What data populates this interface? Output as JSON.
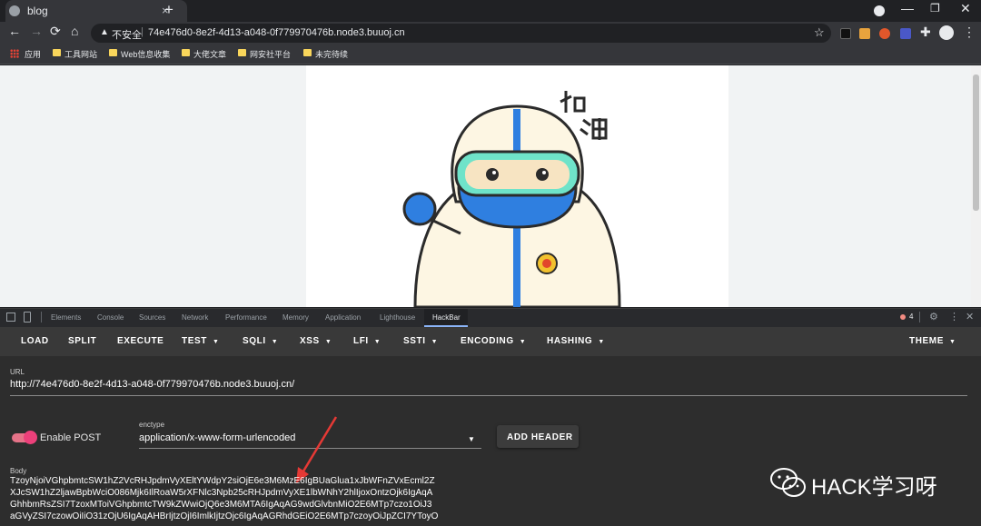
{
  "browser": {
    "tab_title": "blog",
    "new_tab": "+",
    "tab_close": "×",
    "window_controls": {
      "minimize": "—",
      "maximize": "❐",
      "close": "✕"
    },
    "nav": {
      "back": "←",
      "forward": "→",
      "reload": "⟳",
      "home": "⌂"
    },
    "security_label": "不安全",
    "url": "74e476d0-8e2f-4d13-a048-0f779970476b.node3.buuoj.cn",
    "bookmarks": [
      "应用",
      "工具网站",
      "Web信息收集",
      "大佬文章",
      "网安社平台",
      "未完待续"
    ]
  },
  "devtools": {
    "tabs": [
      "Elements",
      "Console",
      "Sources",
      "Network",
      "Performance",
      "Memory",
      "Application",
      "Lighthouse",
      "HackBar"
    ],
    "error_count": "4",
    "gear": "⚙",
    "more": "⋮",
    "close": "✕"
  },
  "hackbar": {
    "menu": [
      "LOAD",
      "SPLIT",
      "EXECUTE",
      "TEST",
      "SQLI",
      "XSS",
      "LFI",
      "SSTI",
      "ENCODING",
      "HASHING",
      "THEME"
    ],
    "dropdown_caret": "▼",
    "url_label": "URL",
    "url_value": "http://74e476d0-8e2f-4d13-a048-0f779970476b.node3.buuoj.cn/",
    "enable_post_label": "Enable POST",
    "enable_post_on": true,
    "enctype_label": "enctype",
    "enctype_value": "application/x-www-form-urlencoded",
    "add_header_label": "ADD HEADER",
    "body_label": "Body",
    "body_lines": [
      "TzoyNjoiVGhpbmtcSW1hZ2VcRHJpdmVyXEltYWdpY2siOjE6e3M6MzE6IgBUaGlua1xJbWFnZVxEcml2Z",
      "XJcSW1hZ2ljawBpbWciO086Mjk6IlRoaW5rXFNlc3Npb25cRHJpdmVyXE1lbWNhY2hlIjoxOntzOjk6IgAqA",
      "GhhbmRsZSI7TzoxMToiVGhpbmtcTW9kZWwiOjQ6e3M6MTA6IgAqAG9wdGlvbnMiO2E6MTp7czo1OiJ3",
      "aGVyZSI7czowOiIiO31zOjU6IgAqAHBrIjtzOjI6ImlkIjtzOjc6IgAqAGRhdGEiO2E6MTp7czoyOiJpZCI7YToyO"
    ]
  },
  "watermark": {
    "text": "HACK学习呀"
  },
  "colors": {
    "accent_toggle": "#ec407a",
    "devtools_bg": "#2d2d2d",
    "menu_bg": "#393939"
  }
}
